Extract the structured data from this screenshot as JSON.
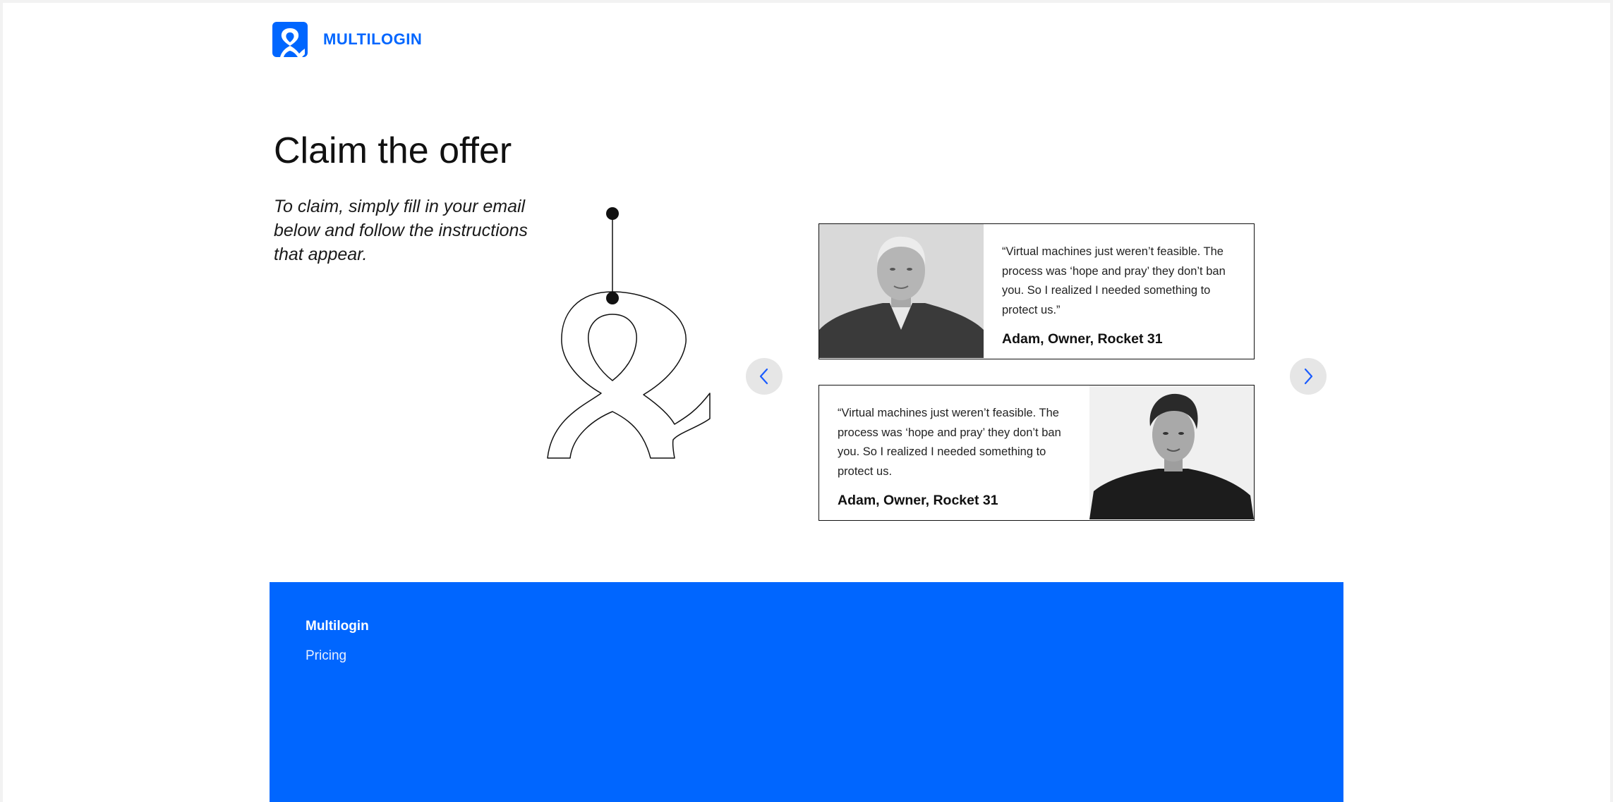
{
  "header": {
    "logo_text": "MULTILOGIN",
    "logo_icon": "multilogin-logo-icon",
    "brand_color": "#0066ff"
  },
  "hero": {
    "title": "Claim the offer",
    "subtitle": "To claim, simply fill in your email below and follow the instructions that appear."
  },
  "carousel": {
    "prev_icon": "chevron-left-icon",
    "next_icon": "chevron-right-icon",
    "testimonials": [
      {
        "quote": "“Virtual machines just weren’t feasible. The process was ‘hope and pray’ they don’t ban you. So I realized I needed something to protect us.”",
        "author": "Adam, Owner, Rocket 31"
      },
      {
        "quote": "“Virtual machines just weren’t feasible. The process was ‘hope and pray’ they don’t ban you. So I realized I needed something to protect us.",
        "author": "Adam, Owner, Rocket 31"
      }
    ]
  },
  "footer": {
    "brand": "Multilogin",
    "links": [
      "Pricing"
    ],
    "background": "#0066ff"
  }
}
